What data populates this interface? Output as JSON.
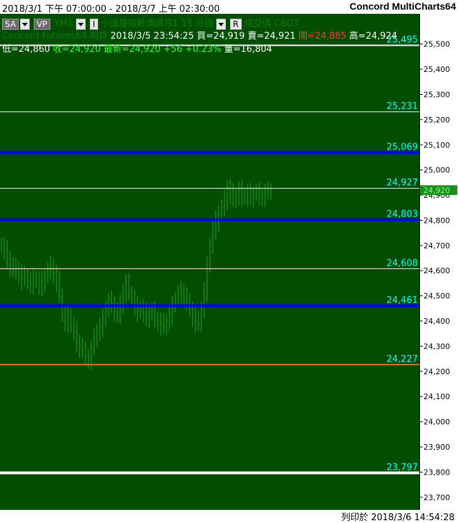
{
  "header": {
    "date_range": "2018/3/1 下午 07:00:00 - 2018/3/7 上午 02:30:00",
    "app_name": "Concord MultiCharts64"
  },
  "toolbar": {
    "sa_label": "SA",
    "vp_label": "VP",
    "symbol": "YM1",
    "i_label": "I",
    "instrument_name": "小道瓊指數連續月1",
    "interval": "15 分鐘",
    "r_label": "R",
    "trade_type": "成交價",
    "exchange": "CBOT"
  },
  "quote": {
    "source": "Concord Futures64",
    "category": "期貨",
    "datetime": "2018/3/5",
    "time": "23:54:25",
    "bid": "買=24,919",
    "ask": "賣=24,921",
    "open": "開=24,885",
    "high": "高=24,924",
    "low": "低=24,860",
    "close": "收=24,920",
    "last": "最新=24,920",
    "change": "+56",
    "change_pct": "+0.23%",
    "volume": "量=16,804"
  },
  "colors": {
    "chart_bg": "#004d00",
    "bars": "#1a8a1a",
    "level_white": "#ffffff",
    "level_blue": "#0000ff",
    "level_orange": "#ff6600",
    "level_label": "#00ffff",
    "last_price_tag": "#1c8f1c"
  },
  "footer": {
    "print_time": "列印於 2018/3/6 14:54:28"
  },
  "chart_data": {
    "type": "bar",
    "subtype": "ohlc",
    "ylim": [
      23650,
      25620
    ],
    "y_ticks": [
      23700,
      23800,
      23900,
      24000,
      24100,
      24200,
      24300,
      24400,
      24500,
      24600,
      24700,
      24800,
      24900,
      25000,
      25100,
      25200,
      25300,
      25400,
      25500
    ],
    "y_tick_labels": [
      "23,700",
      "23,800",
      "23,900",
      "24,000",
      "24,100",
      "24,200",
      "24,300",
      "24,400",
      "24,500",
      "24,600",
      "24,700",
      "24,800",
      "24,900",
      "25,000",
      "25,100",
      "25,200",
      "25,300",
      "25,400",
      "25,500"
    ],
    "last_price": 24920,
    "last_price_label": "24,920",
    "levels": [
      {
        "value": 25495,
        "label": "25,495",
        "color": "#ffffff",
        "weight": "medium"
      },
      {
        "value": 25231,
        "label": "25,231",
        "color": "#ffffff",
        "weight": "thin"
      },
      {
        "value": 25069,
        "label": "25,069",
        "color": "#0000ff",
        "weight": "thick"
      },
      {
        "value": 24927,
        "label": "24,927",
        "color": "#ffffff",
        "weight": "thin"
      },
      {
        "value": 24803,
        "label": "24,803",
        "color": "#0000ff",
        "weight": "thick"
      },
      {
        "value": 24608,
        "label": "24,608",
        "color": "#ffffff",
        "weight": "thin"
      },
      {
        "value": 24461,
        "label": "24,461",
        "color": "#0000ff",
        "weight": "thick"
      },
      {
        "value": 24227,
        "label": "24,227",
        "color": "#ff6600",
        "weight": "medium"
      },
      {
        "value": 23797,
        "label": "23,797",
        "color": "#ffffff",
        "weight": "thick"
      }
    ],
    "close_series": [
      24700,
      24680,
      24650,
      24620,
      24600,
      24610,
      24590,
      24570,
      24580,
      24560,
      24550,
      24570,
      24560,
      24540,
      24560,
      24580,
      24600,
      24620,
      24590,
      24560,
      24500,
      24430,
      24400,
      24420,
      24380,
      24360,
      24320,
      24300,
      24280,
      24260,
      24250,
      24290,
      24330,
      24360,
      24380,
      24410,
      24450,
      24480,
      24470,
      24440,
      24420,
      24470,
      24520,
      24550,
      24510,
      24490,
      24460,
      24440,
      24450,
      24430,
      24420,
      24430,
      24440,
      24410,
      24400,
      24390,
      24380,
      24400,
      24430,
      24460,
      24490,
      24510,
      24520,
      24500,
      24470,
      24450,
      24420,
      24400,
      24390,
      24450,
      24520,
      24620,
      24700,
      24760,
      24800,
      24830,
      24850,
      24880,
      24930,
      24910,
      24880,
      24900,
      24920,
      24900,
      24890,
      24910,
      24900,
      24905,
      24910,
      24895,
      24900,
      24910,
      24915,
      24920
    ]
  }
}
